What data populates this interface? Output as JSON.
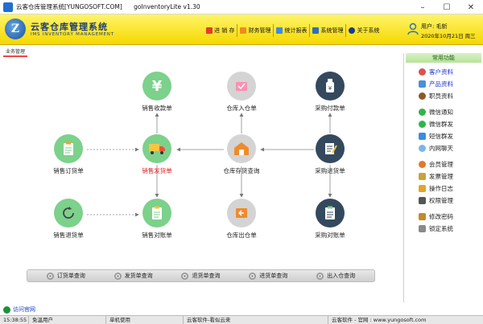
{
  "window": {
    "title": "云客仓库管理系统[YUNGOSOFT.COM]",
    "version": "goInventoryLite v1.30",
    "minimize": "–",
    "maximize": "☐",
    "close": "✕"
  },
  "header": {
    "logo_letter": "Z",
    "brand_title": "云客仓库管理系统",
    "brand_subtitle": "IMS INVENTORY MANAGEMENT",
    "menu": [
      {
        "label": "进 销 存",
        "color": "#e53b2c"
      },
      {
        "label": "财务管理",
        "color": "#f08a1c"
      },
      {
        "label": "统计报表",
        "color": "#3a8de0"
      },
      {
        "label": "系统管理",
        "color": "#2f6fb6"
      },
      {
        "label": "关于系统",
        "color": "#1a3b8f"
      }
    ],
    "user_label": "用户: 毛斩",
    "date_label": "2020年10月21日 周三"
  },
  "main": {
    "section_tab": "业务管理",
    "nodes": {
      "sales_receipt": "销售收款单",
      "inbound": "仓库入仓单",
      "purchase_payment": "采购付款单",
      "sales_order": "销售订货单",
      "sales_delivery": "销售发货单",
      "stock_query": "仓库存货查询",
      "purchase_in": "采购进货单",
      "sales_return": "销售退货单",
      "sales_reconcile": "销售对账单",
      "outbound": "仓库出仓单",
      "purchase_reconcile": "采购对账单"
    },
    "yen_symbol": "¥",
    "queries": [
      "订货单查询",
      "发货单查询",
      "退货单查询",
      "进货单查询",
      "出入仓查询"
    ],
    "visit_link": "访问官网"
  },
  "sidebar": {
    "title": "常用功能",
    "groups": [
      [
        {
          "label": "客户资料",
          "color": "#d9534f",
          "highlight": true
        },
        {
          "label": "产品资料",
          "color": "#4a90d9",
          "highlight": true
        },
        {
          "label": "职员资料",
          "color": "#8b5a2b",
          "highlight": false
        }
      ],
      [
        {
          "label": "微信通知",
          "color": "#2fb54a",
          "highlight": false
        },
        {
          "label": "微信群发",
          "color": "#2fb54a",
          "highlight": false
        },
        {
          "label": "短信群发",
          "color": "#3a8de0",
          "highlight": false
        },
        {
          "label": "内网聊天",
          "color": "#7ab6ea",
          "highlight": false
        }
      ],
      [
        {
          "label": "会员管理",
          "color": "#e07a2a",
          "highlight": false
        },
        {
          "label": "发票管理",
          "color": "#c9a33a",
          "highlight": false
        },
        {
          "label": "操作日志",
          "color": "#e2a52b",
          "highlight": false
        },
        {
          "label": "权限管理",
          "color": "#555555",
          "highlight": false
        }
      ],
      [
        {
          "label": "修改密码",
          "color": "#c28a2a",
          "highlight": false
        },
        {
          "label": "锁定系统",
          "color": "#8a8a8a",
          "highlight": false
        }
      ]
    ]
  },
  "statusbar": {
    "time": "15:38:55",
    "user": "免温用户",
    "mode": "单机使用",
    "vendor": "云客软件-看似云来",
    "site": "云客软件 - 官网 : www.yungosoft.com"
  },
  "colors": {
    "header_yellow": "#f7e01a",
    "node_green": "#7cd18b",
    "node_grey": "#d4d4d4",
    "node_dark": "#34495e",
    "active_red": "#e31b1b"
  }
}
